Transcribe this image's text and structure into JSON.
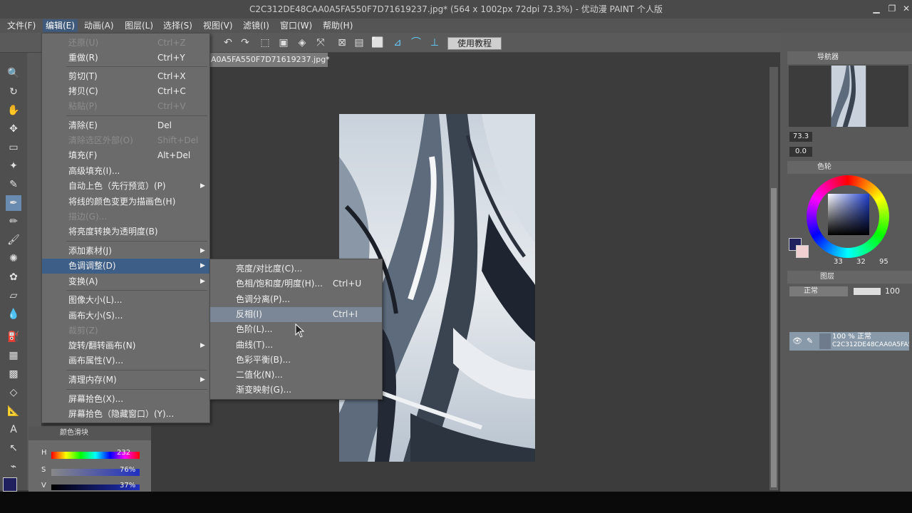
{
  "window": {
    "title": "C2C312DE48CAA0A5FA550F7D71619237.jpg* (564 x 1002px 72dpi 73.3%)  - 优动漫 PAINT 个人版"
  },
  "menubar": [
    "文件(F)",
    "编辑(E)",
    "动画(A)",
    "图层(L)",
    "选择(S)",
    "视图(V)",
    "滤镜(I)",
    "窗口(W)",
    "帮助(H)"
  ],
  "toolbar": {
    "tutorial_label": "使用教程"
  },
  "document_tab": {
    "label": "A0A5FA550F7D71619237.jpg*"
  },
  "edit_menu": [
    {
      "label": "还原(U)",
      "shortcut": "Ctrl+Z",
      "disabled": true
    },
    {
      "label": "重做(R)",
      "shortcut": "Ctrl+Y"
    },
    {
      "label": "剪切(T)",
      "shortcut": "Ctrl+X"
    },
    {
      "label": "拷贝(C)",
      "shortcut": "Ctrl+C"
    },
    {
      "label": "粘贴(P)",
      "shortcut": "Ctrl+V",
      "disabled": true
    },
    {
      "label": "清除(E)",
      "shortcut": "Del"
    },
    {
      "label": "清除选区外部(O)",
      "shortcut": "Shift+Del",
      "disabled": true
    },
    {
      "label": "填充(F)",
      "shortcut": "Alt+Del"
    },
    {
      "label": "高级填充(I)..."
    },
    {
      "label": "自动上色（先行预览）(P)",
      "submenu": true
    },
    {
      "label": "将线的颜色变更为描画色(H)"
    },
    {
      "label": "描边(G)...",
      "disabled": true
    },
    {
      "label": "将亮度转换为透明度(B)"
    },
    {
      "label": "添加素材(J)",
      "submenu": true
    },
    {
      "label": "色调调整(D)",
      "submenu": true,
      "highlighted": true
    },
    {
      "label": "变换(A)",
      "submenu": true
    },
    {
      "label": "图像大小(L)..."
    },
    {
      "label": "画布大小(S)..."
    },
    {
      "label": "裁剪(Z)",
      "disabled": true
    },
    {
      "label": "旋转/翻转画布(N)",
      "submenu": true
    },
    {
      "label": "画布属性(V)..."
    },
    {
      "label": "清理内存(M)",
      "submenu": true
    },
    {
      "label": "屏幕拾色(X)..."
    },
    {
      "label": "屏幕拾色（隐藏窗口）(Y)..."
    }
  ],
  "tone_submenu": [
    {
      "label": "亮度/对比度(C)..."
    },
    {
      "label": "色相/饱和度/明度(H)...",
      "shortcut": "Ctrl+U"
    },
    {
      "label": "色调分离(P)..."
    },
    {
      "label": "反相(I)",
      "shortcut": "Ctrl+I",
      "highlighted": true
    },
    {
      "label": "色阶(L)..."
    },
    {
      "label": "曲线(T)..."
    },
    {
      "label": "色彩平衡(B)..."
    },
    {
      "label": "二值化(N)..."
    },
    {
      "label": "渐变映射(G)..."
    }
  ],
  "color_slider_panel": {
    "title": "颜色滑块",
    "h_label": "H",
    "h_value": "232",
    "s_label": "S",
    "s_value": "76%",
    "v_label": "V",
    "v_value": "37%"
  },
  "navigator": {
    "title": "导航器",
    "zoom": "73.3",
    "rotation": "0.0"
  },
  "color_wheel": {
    "title": "色轮",
    "r": "33",
    "g": "32",
    "b": "95",
    "main_color": "#20205f",
    "sub_color": "#f0d0d0"
  },
  "layer_panel": {
    "title": "图层",
    "blend_mode": "正常",
    "opacity": "100",
    "layer_line1": "100 % 正常",
    "layer_line2": "C2C312DE48CAA0A5FA5..."
  },
  "icons": [
    "minimize-icon",
    "maximize-icon",
    "close-icon",
    "zoom-icon",
    "hand-icon",
    "pen-icon",
    "eraser-icon",
    "fill-icon",
    "text-icon",
    "eye-icon",
    "undo-icon",
    "redo-icon"
  ]
}
